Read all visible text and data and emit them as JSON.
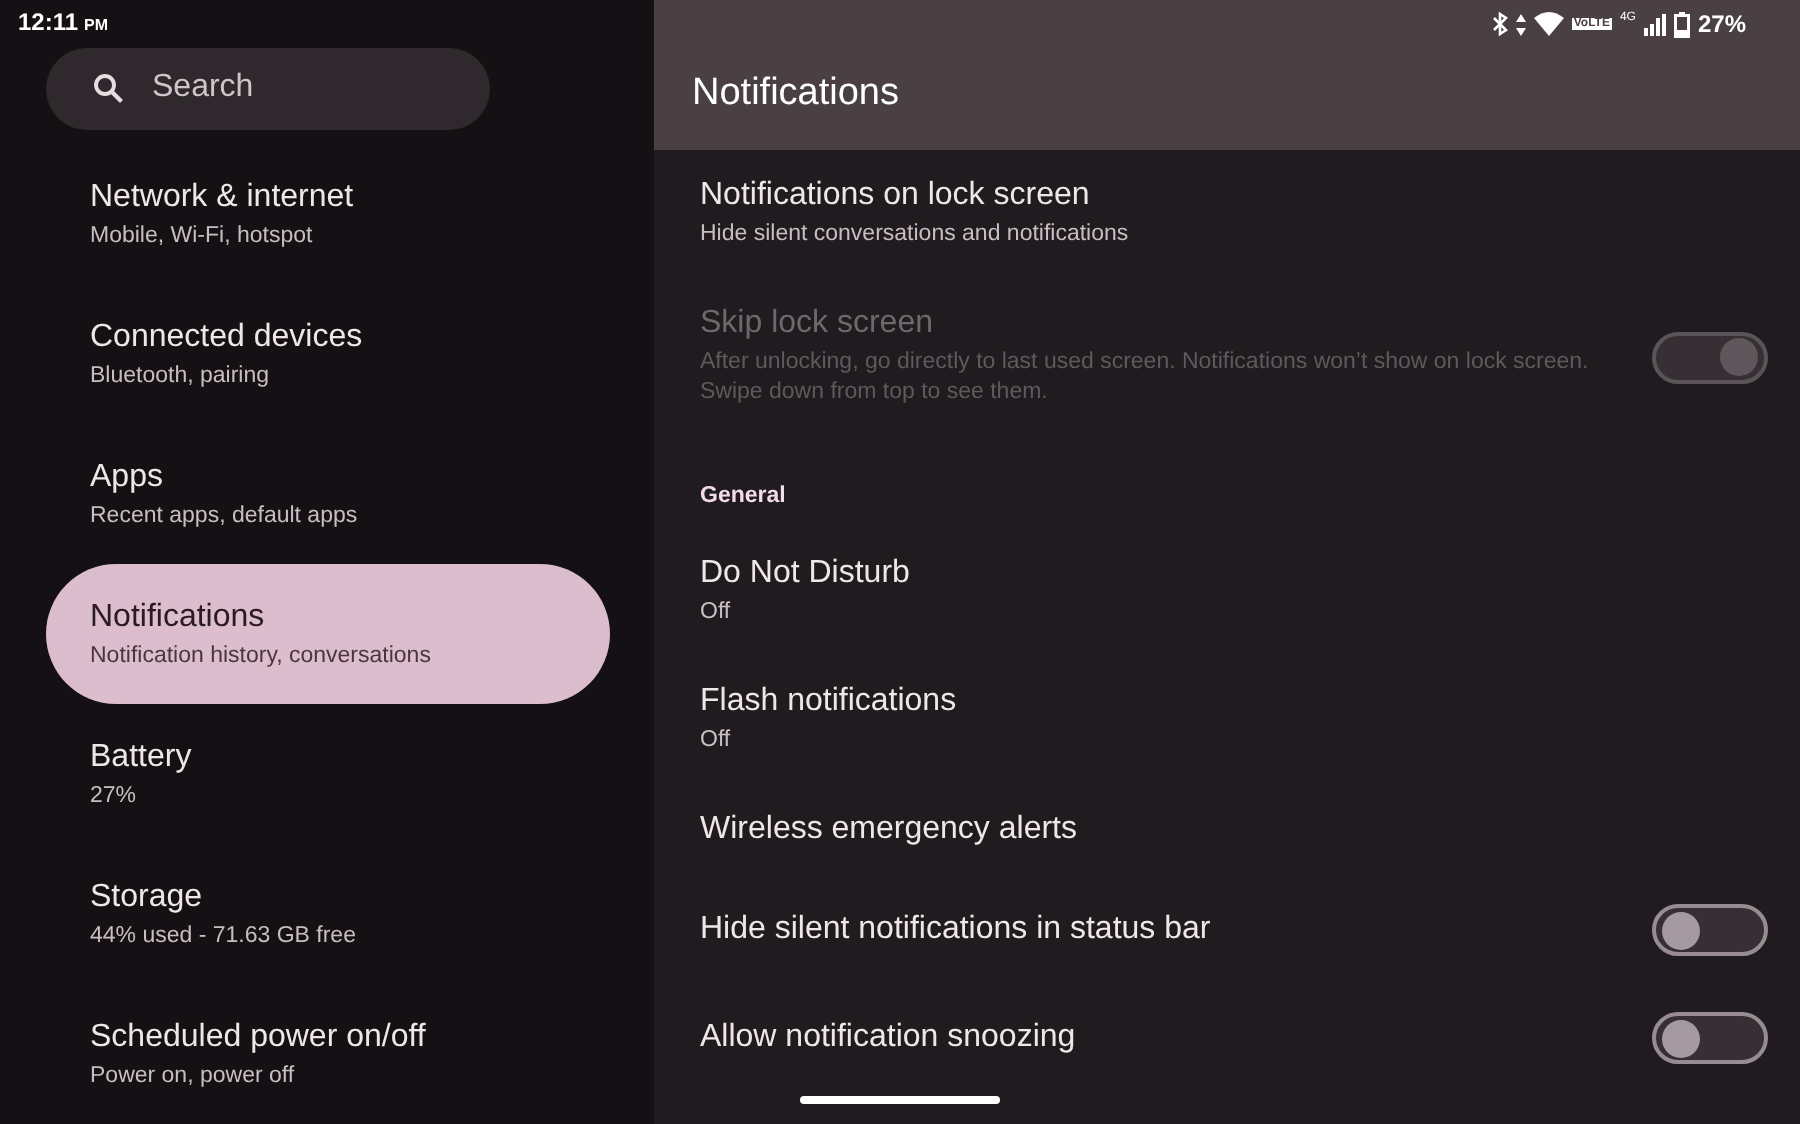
{
  "status_bar": {
    "time": "12:11",
    "ampm": "PM",
    "volte": "VoLTE",
    "network": "4G",
    "battery": "27%"
  },
  "search": {
    "placeholder": "Search"
  },
  "sidebar": {
    "items": [
      {
        "title": "Network & internet",
        "subtitle": "Mobile, Wi-Fi, hotspot",
        "selected": false
      },
      {
        "title": "Connected devices",
        "subtitle": "Bluetooth, pairing",
        "selected": false
      },
      {
        "title": "Apps",
        "subtitle": "Recent apps, default apps",
        "selected": false
      },
      {
        "title": "Notifications",
        "subtitle": "Notification history, conversations",
        "selected": true
      },
      {
        "title": "Battery",
        "subtitle": "27%",
        "selected": false
      },
      {
        "title": "Storage",
        "subtitle": "44% used - 71.63 GB free",
        "selected": false
      },
      {
        "title": "Scheduled power on/off",
        "subtitle": "Power on, power off",
        "selected": false
      }
    ]
  },
  "page": {
    "title": "Notifications",
    "rows": [
      {
        "kind": "item",
        "title": "Notifications on lock screen",
        "subtitle": "Hide silent conversations and notifications",
        "disabled": false
      },
      {
        "kind": "switch",
        "title": "Skip lock screen",
        "subtitle": "After unlocking, go directly to last used screen. Notifications won’t show on lock screen. Swipe down from top to see them.",
        "disabled": true,
        "on": true
      },
      {
        "kind": "header",
        "title": "General"
      },
      {
        "kind": "item",
        "title": "Do Not Disturb",
        "subtitle": "Off",
        "disabled": false
      },
      {
        "kind": "item",
        "title": "Flash notifications",
        "subtitle": "Off",
        "disabled": false
      },
      {
        "kind": "item",
        "title": "Wireless emergency alerts",
        "disabled": false
      },
      {
        "kind": "switch",
        "title": "Hide silent notifications in status bar",
        "disabled": false,
        "on": false
      },
      {
        "kind": "switch",
        "title": "Allow notification snoozing",
        "disabled": false,
        "on": false
      }
    ]
  }
}
